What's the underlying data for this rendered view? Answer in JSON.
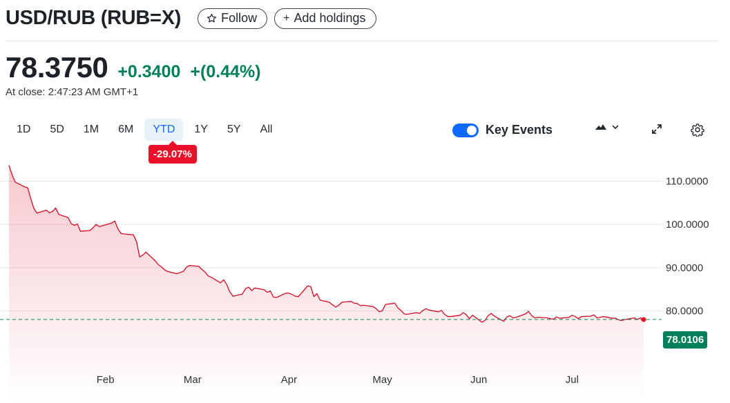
{
  "header": {
    "title": "USD/RUB (RUB=X)",
    "follow_label": "Follow",
    "add_holdings_label": "Add holdings",
    "follow_icon": "star-outline-icon",
    "add_icon": "plus-icon"
  },
  "quote": {
    "price": "78.3750",
    "change": "+0.3400",
    "change_pct": "+(0.44%)",
    "close_text": "At close: 2:47:23 AM GMT+1"
  },
  "ranges": [
    "1D",
    "5D",
    "1M",
    "6M",
    "YTD",
    "1Y",
    "5Y",
    "All"
  ],
  "active_range": "YTD",
  "range_change_badge": "-29.07%",
  "key_events": {
    "label": "Key Events",
    "enabled": true
  },
  "toolbar": {
    "chart_type_icon": "mountain-chart-icon",
    "expand_icon": "expand-icon",
    "settings_icon": "gear-icon"
  },
  "colors": {
    "line": "#d60a22",
    "positive": "#00805a",
    "negative": "#eb0f29",
    "accent": "#0f69ff"
  },
  "chart_data": {
    "type": "area",
    "current_value_label": "78.0106",
    "y_ticks": [
      "110.0000",
      "100.0000",
      "90.0000",
      "80.0000"
    ],
    "ylim": [
      74.5,
      113.6
    ],
    "x_ticks": [
      {
        "label": "Feb",
        "x": "2025-02-01"
      },
      {
        "label": "Mar",
        "x": "2025-03-01"
      },
      {
        "label": "Apr",
        "x": "2025-04-01"
      },
      {
        "label": "May",
        "x": "2025-05-01"
      },
      {
        "label": "Jun",
        "x": "2025-06-01"
      },
      {
        "label": "Jul",
        "x": "2025-07-01"
      }
    ],
    "grid": true,
    "series": [
      {
        "x": [
          "2025-01-01",
          "2025-01-02",
          "2025-01-03",
          "2025-01-06",
          "2025-01-07",
          "2025-01-08",
          "2025-01-09",
          "2025-01-10",
          "2025-01-13",
          "2025-01-14",
          "2025-01-15",
          "2025-01-16",
          "2025-01-17",
          "2025-01-20",
          "2025-01-21",
          "2025-01-22",
          "2025-01-23",
          "2025-01-24",
          "2025-01-27",
          "2025-01-28",
          "2025-01-29",
          "2025-01-30",
          "2025-01-31",
          "2025-02-03",
          "2025-02-04",
          "2025-02-05",
          "2025-02-06",
          "2025-02-07",
          "2025-02-10",
          "2025-02-11",
          "2025-02-12",
          "2025-02-13",
          "2025-02-14",
          "2025-02-17",
          "2025-02-18",
          "2025-02-19",
          "2025-02-20",
          "2025-02-21",
          "2025-02-24",
          "2025-02-25",
          "2025-02-26",
          "2025-02-27",
          "2025-02-28",
          "2025-03-03",
          "2025-03-04",
          "2025-03-05",
          "2025-03-06",
          "2025-03-07",
          "2025-03-10",
          "2025-03-11",
          "2025-03-12",
          "2025-03-13",
          "2025-03-14",
          "2025-03-17",
          "2025-03-18",
          "2025-03-19",
          "2025-03-20",
          "2025-03-21",
          "2025-03-24",
          "2025-03-25",
          "2025-03-26",
          "2025-03-27",
          "2025-03-28",
          "2025-03-31",
          "2025-04-01",
          "2025-04-02",
          "2025-04-03",
          "2025-04-04",
          "2025-04-07",
          "2025-04-08",
          "2025-04-09",
          "2025-04-10",
          "2025-04-11",
          "2025-04-14",
          "2025-04-15",
          "2025-04-16",
          "2025-04-17",
          "2025-04-18",
          "2025-04-21",
          "2025-04-22",
          "2025-04-23",
          "2025-04-24",
          "2025-04-25",
          "2025-04-28",
          "2025-04-29",
          "2025-04-30",
          "2025-05-01",
          "2025-05-02",
          "2025-05-05",
          "2025-05-06",
          "2025-05-07",
          "2025-05-08",
          "2025-05-09",
          "2025-05-12",
          "2025-05-13",
          "2025-05-14",
          "2025-05-15",
          "2025-05-16",
          "2025-05-19",
          "2025-05-20",
          "2025-05-21",
          "2025-05-22",
          "2025-05-23",
          "2025-05-26",
          "2025-05-27",
          "2025-05-28",
          "2025-05-29",
          "2025-05-30",
          "2025-06-02",
          "2025-06-03",
          "2025-06-04",
          "2025-06-05",
          "2025-06-06",
          "2025-06-09",
          "2025-06-10",
          "2025-06-11",
          "2025-06-12",
          "2025-06-13",
          "2025-06-16",
          "2025-06-17",
          "2025-06-18",
          "2025-06-19",
          "2025-06-20",
          "2025-06-23",
          "2025-06-24",
          "2025-06-25",
          "2025-06-26",
          "2025-06-27",
          "2025-06-30",
          "2025-07-01",
          "2025-07-02",
          "2025-07-03",
          "2025-07-04",
          "2025-07-07",
          "2025-07-08",
          "2025-07-09",
          "2025-07-10",
          "2025-07-11",
          "2025-07-14",
          "2025-07-15",
          "2025-07-16",
          "2025-07-17",
          "2025-07-18",
          "2025-07-21",
          "2025-07-22",
          "2025-07-23",
          "2025-07-24"
        ],
        "values": [
          113.7,
          111.5,
          109.8,
          108.7,
          108.5,
          106.0,
          103.7,
          102.6,
          103.3,
          102.7,
          103.0,
          103.8,
          102.3,
          101.6,
          100.2,
          99.8,
          100.1,
          98.4,
          98.6,
          99.2,
          100.0,
          99.5,
          99.7,
          100.3,
          100.8,
          99.0,
          97.9,
          97.8,
          97.6,
          96.0,
          92.5,
          92.9,
          93.6,
          91.6,
          90.7,
          90.2,
          89.5,
          89.1,
          88.6,
          88.9,
          89.1,
          90.1,
          90.5,
          90.3,
          89.6,
          89.0,
          88.1,
          87.8,
          86.5,
          87.2,
          86.1,
          84.4,
          83.4,
          83.9,
          85.1,
          85.5,
          84.7,
          85.3,
          84.9,
          84.3,
          84.6,
          83.2,
          83.1,
          84.1,
          84.1,
          83.8,
          83.4,
          83.3,
          85.8,
          85.6,
          83.3,
          84.0,
          82.5,
          82.0,
          81.4,
          80.9,
          81.3,
          82.0,
          82.2,
          81.8,
          81.7,
          81.2,
          81.3,
          81.0,
          80.5,
          79.8,
          80.0,
          81.5,
          81.8,
          80.7,
          80.1,
          79.3,
          79.2,
          79.6,
          79.4,
          80.1,
          80.5,
          80.2,
          79.8,
          80.1,
          79.2,
          78.7,
          78.7,
          79.0,
          79.6,
          79.1,
          78.2,
          79.0,
          77.4,
          77.8,
          78.9,
          79.4,
          78.8,
          77.6,
          78.6,
          78.9,
          78.4,
          78.5,
          79.3,
          79.9,
          78.9,
          78.4,
          78.5,
          78.4,
          78.2,
          78.1,
          78.6,
          78.3,
          78.5,
          79.0,
          78.7,
          78.2,
          78.7,
          78.8,
          79.1,
          78.4,
          78.5,
          78.7,
          78.3,
          78.3,
          77.9,
          77.8,
          78.0,
          78.4,
          78.0,
          78.4,
          78.0
        ]
      }
    ]
  }
}
